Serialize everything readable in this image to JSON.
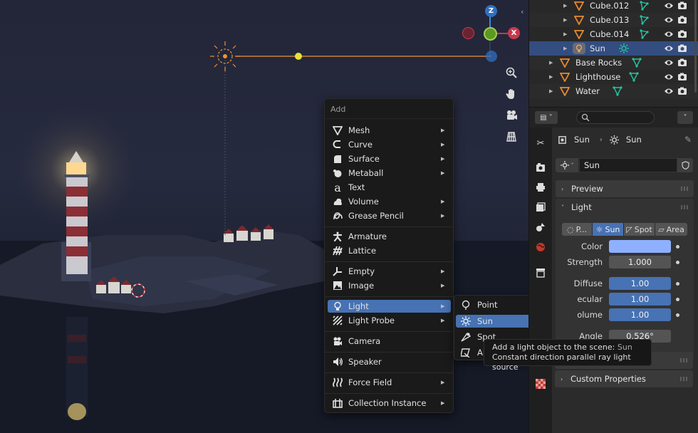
{
  "viewport": {
    "gizmo": {
      "z_label": "Z",
      "x_label": "X"
    }
  },
  "add_menu": {
    "title": "Add",
    "items": [
      {
        "label": "Mesh",
        "icon": "mesh-icon"
      },
      {
        "label": "Curve",
        "icon": "curve-icon"
      },
      {
        "label": "Surface",
        "icon": "surface-icon"
      },
      {
        "label": "Metaball",
        "icon": "metaball-icon"
      },
      {
        "label": "Text",
        "icon": "text-icon"
      },
      {
        "label": "Volume",
        "icon": "volume-icon"
      },
      {
        "label": "Grease Pencil",
        "icon": "grease-pencil-icon"
      },
      {
        "label": "Armature",
        "icon": "armature-icon"
      },
      {
        "label": "Lattice",
        "icon": "lattice-icon"
      },
      {
        "label": "Empty",
        "icon": "empty-icon"
      },
      {
        "label": "Image",
        "icon": "image-icon"
      },
      {
        "label": "Light",
        "icon": "light-icon"
      },
      {
        "label": "Light Probe",
        "icon": "light-probe-icon"
      },
      {
        "label": "Camera",
        "icon": "camera-icon"
      },
      {
        "label": "Speaker",
        "icon": "speaker-icon"
      },
      {
        "label": "Force Field",
        "icon": "force-field-icon"
      },
      {
        "label": "Collection Instance",
        "icon": "collection-instance-icon"
      }
    ]
  },
  "light_submenu": {
    "items": [
      {
        "label": "Point",
        "icon": "point-light-icon"
      },
      {
        "label": "Sun",
        "icon": "sun-light-icon"
      },
      {
        "label": "Spot",
        "icon": "spot-light-icon"
      },
      {
        "label": "Area",
        "icon": "area-light-icon"
      }
    ]
  },
  "tooltip": {
    "line1": "Add a light object to the scene:",
    "line1_value": "Sun",
    "line2": "Constant direction parallel ray light source"
  },
  "outliner": {
    "rows": [
      {
        "label": "Cube.012"
      },
      {
        "label": "Cube.013"
      },
      {
        "label": "Cube.014"
      },
      {
        "label": "Sun"
      },
      {
        "label": "Base Rocks"
      },
      {
        "label": "Lighthouse"
      },
      {
        "label": "Water"
      }
    ]
  },
  "properties": {
    "breadcrumb_object": "Sun",
    "breadcrumb_data": "Sun",
    "datablock_name": "Sun",
    "panels": {
      "preview": "Preview",
      "light": "Light",
      "custom": "Custom Properties"
    },
    "light_types": [
      "P...",
      "Sun",
      "Spot",
      "Area"
    ],
    "fields": {
      "color_label": "Color",
      "strength_label": "Strength",
      "strength_value": "1.000",
      "diffuse_label": "Diffuse",
      "diffuse_value": "1.00",
      "specular_label": "ecular",
      "specular_value": "1.00",
      "volume_label": "olume",
      "volume_value": "1.00",
      "angle_label": "Angle",
      "angle_value": "0.526°"
    },
    "colors": {
      "light_color": "#8fb0ff",
      "accent": "#4772b3"
    }
  }
}
